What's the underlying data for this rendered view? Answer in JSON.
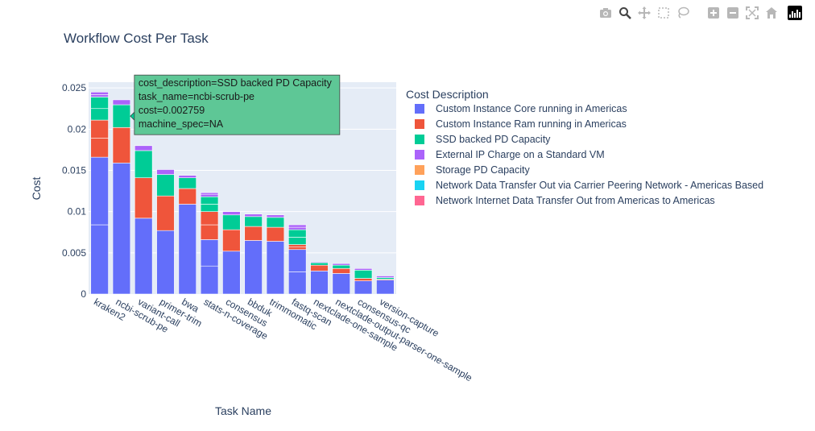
{
  "modebar": {
    "buttons": [
      "camera-icon",
      "zoom-icon",
      "pan-icon",
      "box-select-icon",
      "lasso-select-icon",
      "zoom-in-icon",
      "zoom-out-icon",
      "autoscale-icon",
      "reset-axes-icon",
      "plotly-logo-icon"
    ]
  },
  "colors": {
    "plot_bg": "#e5ecf6",
    "bar_outline": "#ffffff",
    "series": [
      "#636efa",
      "#ef553b",
      "#00cc96",
      "#ab63fa",
      "#ffa15a",
      "#19d3f3",
      "#ff6692"
    ]
  },
  "chart_data": {
    "type": "bar",
    "barmode": "stack",
    "title": "Workflow Cost Per Task",
    "xlabel": "Task Name",
    "ylabel": "Cost",
    "ylim": [
      0,
      0.0257
    ],
    "yticks": [
      0,
      0.005,
      0.01,
      0.015,
      0.02,
      0.025
    ],
    "ytick_labels": [
      "0",
      "0.005",
      "0.01",
      "0.015",
      "0.02",
      "0.025"
    ],
    "grid": true,
    "legend_title": "Cost Description",
    "legend_position": "right",
    "categories": [
      "kraken2",
      "ncbi-scrub-pe",
      "variant-call",
      "primer-trim",
      "bwa",
      "stats-n-coverage",
      "consensus",
      "bbduk",
      "trimmomatic",
      "fastq-scan",
      "nextclade-one-sample",
      "nextclade-output-parser-one-sample",
      "consensus-qc",
      "version-capture"
    ],
    "series": [
      {
        "name": "Custom Instance Core running in Americas",
        "segments": [
          [
            0.0084,
            0.0082
          ],
          [
            0.0159
          ],
          [
            0.0092
          ],
          [
            0.0077
          ],
          [
            0.0109
          ],
          [
            0.0034,
            0.0032
          ],
          [
            0.0052
          ],
          [
            0.0065
          ],
          [
            0.0064
          ],
          [
            0.0027,
            0.0027
          ],
          [
            0.0028
          ],
          [
            0.0025
          ],
          [
            0.0016
          ],
          [
            0.0017
          ]
        ]
      },
      {
        "name": "Custom Instance Ram running in Americas",
        "segments": [
          [
            0.0023,
            0.0022
          ],
          [
            0.0043
          ],
          [
            0.0049
          ],
          [
            0.0042
          ],
          [
            0.0019
          ],
          [
            0.0018,
            0.0016
          ],
          [
            0.0026
          ],
          [
            0.0017
          ],
          [
            0.0017
          ],
          [
            0.0003,
            0.0003
          ],
          [
            0.0007
          ],
          [
            0.0006
          ],
          [
            0.0003
          ],
          [
            0.0001
          ]
        ]
      },
      {
        "name": "SSD backed PD Capacity",
        "segments": [
          [
            0.0014,
            0.0014
          ],
          [
            0.002759
          ],
          [
            0.0033
          ],
          [
            0.0026
          ],
          [
            0.0013
          ],
          [
            0.0009,
            0.0009
          ],
          [
            0.0018
          ],
          [
            0.0012
          ],
          [
            0.0012
          ],
          [
            0.0009,
            0.0009
          ],
          [
            0.0003
          ],
          [
            0.0004
          ],
          [
            0.001
          ],
          [
            0.0002
          ]
        ]
      },
      {
        "name": "External IP Charge on a Standard VM",
        "segments": [
          [
            0.0003,
            0.0003
          ],
          [
            0.0006
          ],
          [
            0.0006
          ],
          [
            0.0006
          ],
          [
            0.0003
          ],
          [
            0.0003,
            0.0002
          ],
          [
            0.0004
          ],
          [
            0.0003
          ],
          [
            0.0003
          ],
          [
            0.0003,
            0.0003
          ],
          [
            0.0001
          ],
          [
            0.0002
          ],
          [
            0.0002
          ],
          [
            0.0002
          ]
        ]
      },
      {
        "name": "Storage PD Capacity",
        "segments": [
          [
            0
          ],
          [
            0
          ],
          [
            0
          ],
          [
            0
          ],
          [
            0
          ],
          [
            0
          ],
          [
            0
          ],
          [
            0
          ],
          [
            0
          ],
          [
            0
          ],
          [
            0
          ],
          [
            0
          ],
          [
            0
          ],
          [
            0
          ]
        ]
      },
      {
        "name": "Network Data Transfer Out via Carrier Peering Network - Americas Based",
        "segments": [
          [
            0
          ],
          [
            0
          ],
          [
            0
          ],
          [
            0
          ],
          [
            0
          ],
          [
            0
          ],
          [
            0
          ],
          [
            0
          ],
          [
            0
          ],
          [
            0
          ],
          [
            0
          ],
          [
            0
          ],
          [
            0
          ],
          [
            0
          ]
        ]
      },
      {
        "name": "Network Internet Data Transfer Out from Americas to Americas",
        "segments": [
          [
            0
          ],
          [
            0
          ],
          [
            0
          ],
          [
            0
          ],
          [
            0
          ],
          [
            0
          ],
          [
            0
          ],
          [
            0
          ],
          [
            0
          ],
          [
            0
          ],
          [
            0
          ],
          [
            0
          ],
          [
            0
          ],
          [
            0
          ]
        ]
      }
    ],
    "hover": {
      "task_index": 1,
      "series_index": 2,
      "lines": [
        "cost_description=SSD backed PD Capacity",
        "task_name=ncbi-scrub-pe",
        "cost=0.002759",
        "machine_spec=NA"
      ]
    }
  }
}
